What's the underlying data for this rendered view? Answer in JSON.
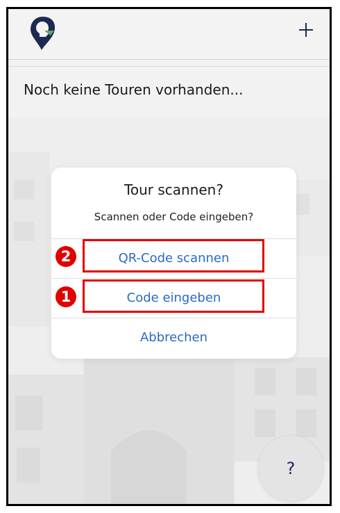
{
  "header": {
    "logo_icon": "map-pin-logo",
    "add_icon": "plus-icon"
  },
  "list": {
    "empty_text": "Noch keine Touren vorhanden..."
  },
  "dialog": {
    "title": "Tour scannen?",
    "message": "Scannen oder Code eingeben?",
    "buttons": [
      {
        "label": "QR-Code scannen",
        "annotation_number": "2"
      },
      {
        "label": "Code eingeben",
        "annotation_number": "1"
      },
      {
        "label": "Abbrechen"
      }
    ]
  },
  "fab": {
    "label": "?"
  },
  "colors": {
    "accent": "#2a6bc2",
    "annotation": "#e00000",
    "logo": "#1c2a52"
  }
}
